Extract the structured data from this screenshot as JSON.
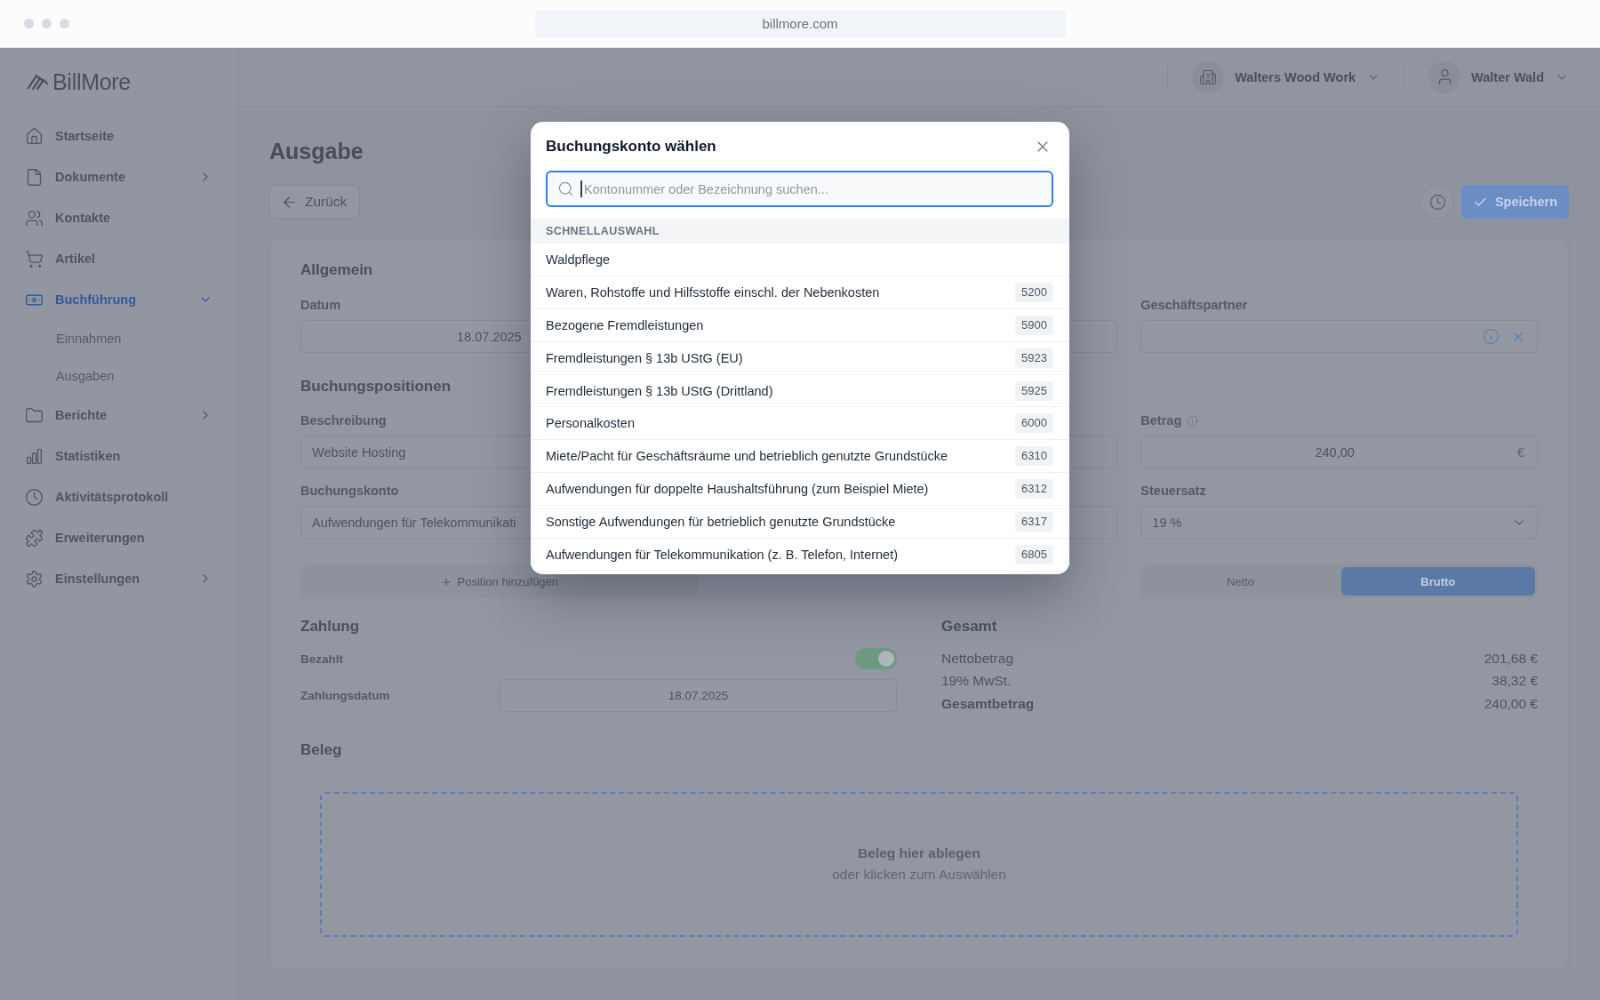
{
  "browser": {
    "url": "billmore.com"
  },
  "sidebar": {
    "brand": "BillMore",
    "items": [
      {
        "label": "Startseite",
        "selected": false
      },
      {
        "label": "Dokumente",
        "selected": false,
        "expanded": false
      },
      {
        "label": "Kontakte",
        "selected": false
      },
      {
        "label": "Artikel",
        "selected": false
      },
      {
        "label": "Buchführung",
        "selected": true,
        "expanded": true,
        "children": [
          {
            "label": "Einnahmen",
            "selected": false
          },
          {
            "label": "Ausgaben",
            "selected": false
          }
        ]
      },
      {
        "label": "Berichte",
        "selected": false,
        "expanded": false
      },
      {
        "label": "Statistiken",
        "selected": false
      },
      {
        "label": "Aktivitätsprotokoll",
        "selected": false
      },
      {
        "label": "Erweiterungen",
        "selected": false
      },
      {
        "label": "Einstellungen",
        "selected": false,
        "expanded": false
      }
    ]
  },
  "header": {
    "company": "Walters Wood Work",
    "user": "Walter Wald"
  },
  "page": {
    "title": "Ausgabe",
    "back": "Zurück",
    "save": "Speichern"
  },
  "form": {
    "general": {
      "title": "Allgemein",
      "fields": [
        {
          "kind": "date",
          "label": "Datum",
          "value": "18.07.2025"
        },
        {
          "kind": "text"
        },
        {
          "kind": "partner",
          "label": "Geschäftspartner"
        }
      ]
    },
    "positions": {
      "title": "Buchungspositionen",
      "rows": [
        [
          {
            "kind": "text",
            "label": "Beschreibung",
            "value": "Website Hosting"
          },
          {
            "kind": "text"
          },
          {
            "kind": "amount",
            "label": "Betrag",
            "value": "240,00",
            "currency": "€"
          }
        ],
        [
          {
            "kind": "text",
            "label": "Buchungskonto",
            "value": "Aufwendungen für Telekommunikati"
          },
          {
            "kind": "text"
          },
          {
            "kind": "select",
            "label": "Steuersatz",
            "value": "19 %"
          }
        ]
      ],
      "add": "Position hinzufügen",
      "modes": [
        {
          "label": "Netto",
          "selected": false
        },
        {
          "label": "Brutto",
          "selected": true
        }
      ]
    },
    "payment": {
      "title": "Zahlung",
      "paid_label": "Bezahlt",
      "paid": true,
      "date_label": "Zahlungsdatum",
      "date_value": "18.07.2025"
    },
    "totals": {
      "title": "Gesamt",
      "rows": [
        {
          "label": "Nettobetrag",
          "value": "201,68 €",
          "bold": false
        },
        {
          "label": "19% MwSt.",
          "value": "38,32 €",
          "bold": false
        },
        {
          "label": "Gesamtbetrag",
          "value": "240,00 €",
          "bold": true
        }
      ]
    },
    "receipt": {
      "title": "Beleg",
      "drop_title": "Beleg hier ablegen",
      "drop_hint": "oder klicken zum Auswählen"
    }
  },
  "modal": {
    "title": "Buchungskonto wählen",
    "search": {
      "placeholder": "Kontonummer oder Bezeichnung suchen..."
    },
    "section": "SCHNELLAUSWAHL",
    "accounts": [
      {
        "name": "Waldpflege",
        "selected": false
      },
      {
        "name": "Waren, Rohstoffe und Hilfsstoffe einschl. der Nebenkosten",
        "number": "5200",
        "selected": false
      },
      {
        "name": "Bezogene Fremdleistungen",
        "number": "5900",
        "selected": false
      },
      {
        "name": "Fremdleistungen § 13b UStG (EU)",
        "number": "5923",
        "selected": false
      },
      {
        "name": "Fremdleistungen § 13b UStG (Drittland)",
        "number": "5925",
        "selected": false
      },
      {
        "name": "Personalkosten",
        "number": "6000",
        "selected": false
      },
      {
        "name": "Miete/Pacht für Geschäftsräume und betrieblich genutzte Grundstücke",
        "number": "6310",
        "selected": false
      },
      {
        "name": "Aufwendungen für doppelte Haushaltsführung (zum Beispiel Miete)",
        "number": "6312",
        "selected": false
      },
      {
        "name": "Sonstige Aufwendungen für betrieblich genutzte Grundstücke",
        "number": "6317",
        "selected": false
      },
      {
        "name": "Aufwendungen für Telekommunikation (z. B. Telefon, Internet)",
        "number": "6805",
        "selected": false
      }
    ]
  }
}
